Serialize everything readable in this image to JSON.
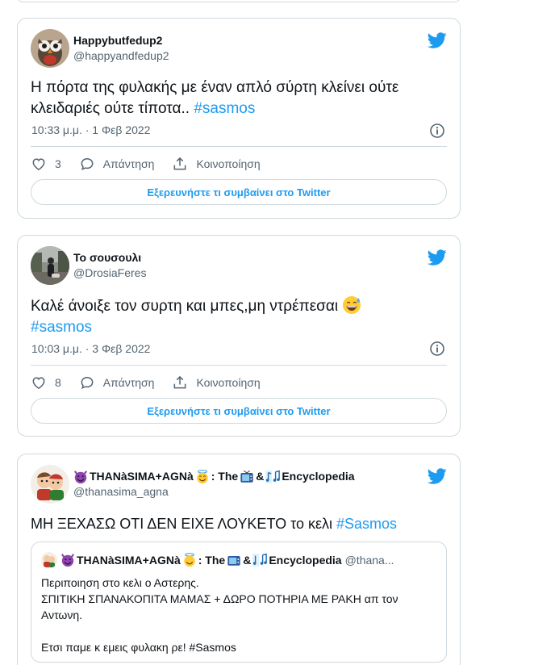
{
  "explore_label": "Εξερευνήστε τι συμβαίνει στο Twitter",
  "colors": {
    "accent": "#1d9bf0",
    "muted": "#536471",
    "border": "#cfd9de"
  },
  "tweets": [
    {
      "display_name": "Happybutfedup2",
      "handle": "@happyandfedup2",
      "text": "Η πόρτα της φυλακής με έναν απλό σύρτη κλείνει ούτε κλειδαριές ούτε τίποτα.. ",
      "hashtag": "#sasmos",
      "timestamp": "10:33 μ.μ. · 1 Φεβ 2022",
      "likes": "3",
      "reply_label": "Απάντηση",
      "share_label": "Κοινοποίηση",
      "avatar_icon": "owl-avatar"
    },
    {
      "display_name": "Το σουσουλι",
      "handle": "@DrosiaFeres",
      "text": "Καλέ άνοιξε τον συρτη και μπες,μη ντρέπεσαι ",
      "hashtag": "#sasmos",
      "timestamp": "10:03 μ.μ. · 3 Φεβ 2022",
      "likes": "8",
      "reply_label": "Απάντηση",
      "share_label": "Κοινοποίηση",
      "avatar_icon": "street-photo-avatar",
      "emoji": "grinning-sweat-emoji"
    },
    {
      "display_name_parts": [
        "THANàSIMA+AGNà",
        ": The ",
        " & ",
        " Encyclopedia"
      ],
      "handle": "@thanasima_agna",
      "text": "ΜΗ ΞΕΧΑΣΩ ΟΤΙ ΔΕΝ ΕΙΧΕ ΛΟΥΚΕΤΟ το κελι ",
      "hashtag": "#Sasmos",
      "avatar_icon": "cartoon-avatar",
      "quote": {
        "display_name_parts": [
          "THANàSIMA+AGNà",
          ": The ",
          " & ",
          " Encyclopedia"
        ],
        "handle": "@thana...",
        "lines": [
          "Περιποιηση στο κελι ο Αστερης.",
          "ΣΠΙΤΙΚΗ ΣΠΑΝΑΚΟΠΙΤΑ ΜΑΜΑΣ + ΔΩΡΟ ΠΟΤΗΡΙΑ ΜΕ ΡΑΚΗ απ τον Αντωνη.",
          "",
          "Ετσι παμε κ εμεις φυλακη ρε! #Sasmos"
        ]
      }
    }
  ]
}
